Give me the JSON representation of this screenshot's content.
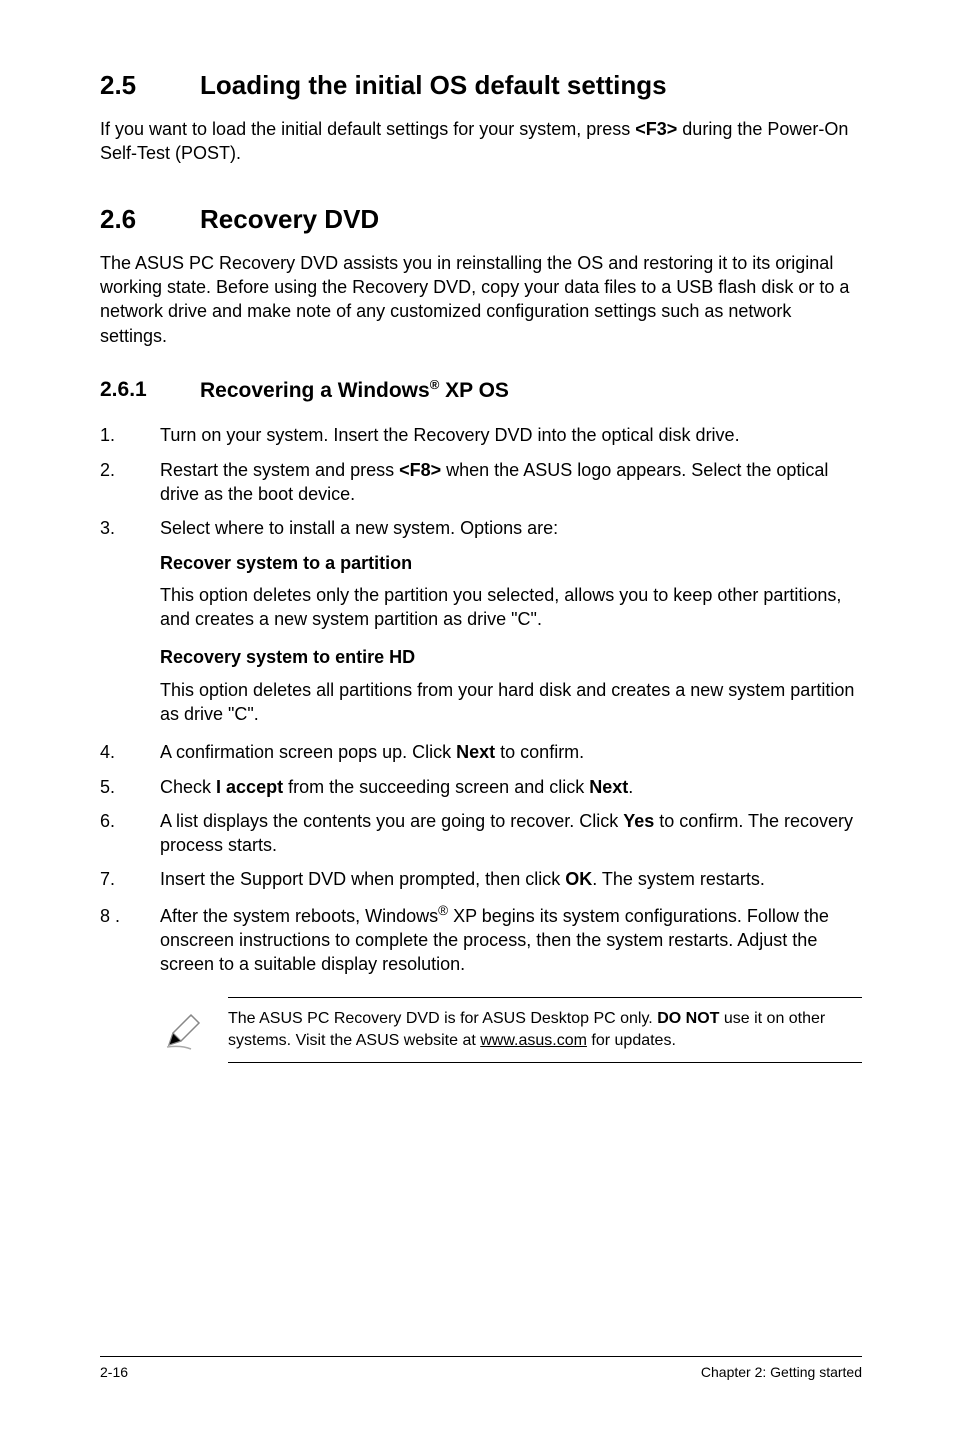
{
  "section25": {
    "num": "2.5",
    "title": "Loading the initial OS default settings",
    "body_before": "If you want to load the initial default settings for your system, press ",
    "body_key": "<F3>",
    "body_after": " during the Power-On Self-Test (POST)."
  },
  "section26": {
    "num": "2.6",
    "title": "Recovery DVD",
    "body": "The ASUS PC Recovery DVD assists you in reinstalling the OS and restoring it to its original working state. Before using the Recovery DVD, copy your data files to a USB flash disk or to a network drive and make note of any customized configuration settings such as network settings."
  },
  "section261": {
    "num": "2.6.1",
    "title_before": "Recovering a Windows",
    "title_sup": "®",
    "title_after": " XP OS"
  },
  "steps_part1": [
    {
      "marker": "1.",
      "text": "Turn on your system. Insert the Recovery DVD into the optical disk drive."
    },
    {
      "marker": "2.",
      "pre": "Restart the system and press ",
      "bold": "<F8>",
      "post": " when the ASUS logo appears. Select the optical drive as the boot device."
    },
    {
      "marker": "3.",
      "text": "Select where to install a new system. Options are:"
    }
  ],
  "recover_partition": {
    "heading": "Recover system to a partition",
    "text": "This option deletes only the partition you selected, allows you to keep other partitions, and creates a new system partition as drive \"C\"."
  },
  "recover_hd": {
    "heading": "Recovery system to entire HD",
    "text": "This option deletes all partitions from your hard disk and creates a new system partition as drive \"C\"."
  },
  "steps_part2": [
    {
      "marker": "4.",
      "pre": "A confirmation screen pops up. Click ",
      "bold": "Next",
      "post": " to confirm."
    },
    {
      "marker": "5.",
      "pre": "Check ",
      "bold": "I accept",
      "mid": " from the succeeding screen and click ",
      "bold2": "Next",
      "post": "."
    },
    {
      "marker": "6.",
      "pre": "A list displays the contents you are going to recover. Click ",
      "bold": "Yes",
      "post": " to confirm. The recovery process starts."
    },
    {
      "marker": "7.",
      "pre": "Insert the Support DVD when prompted, then click ",
      "bold": "OK",
      "post": ". The system restarts."
    },
    {
      "marker": "8 .",
      "pre": "After the system reboots, Windows",
      "sup": "®",
      "post_sup": " XP begins its system configurations. Follow the onscreen instructions to complete the process, then the system restarts. Adjust the screen to a suitable display resolution."
    }
  ],
  "note": {
    "pre": "The ASUS PC Recovery DVD is for ASUS Desktop PC only. ",
    "bold": "DO NOT",
    "mid": " use it on other systems. Visit the ASUS website at ",
    "link": "www.asus.com",
    "post": " for updates."
  },
  "footer": {
    "left": "2-16",
    "right": "Chapter 2: Getting started"
  }
}
